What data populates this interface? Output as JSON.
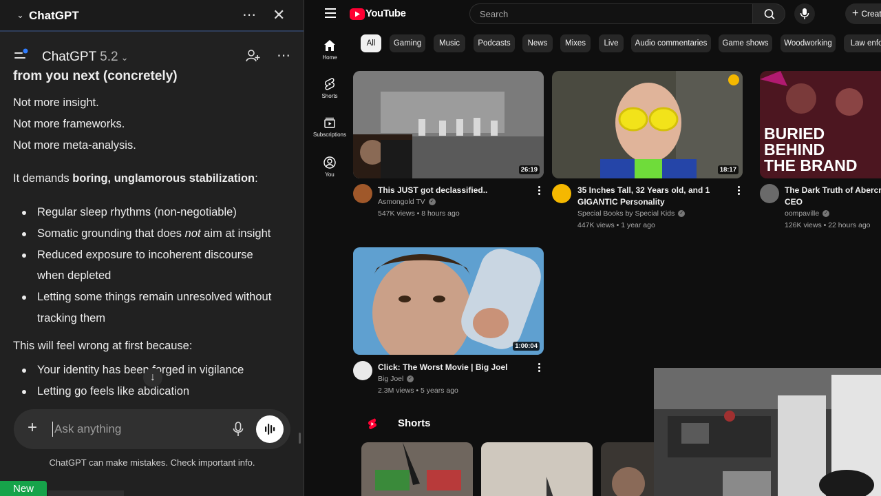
{
  "chatgpt": {
    "window_title": "ChatGPT",
    "model_name": "ChatGPT",
    "model_version": "5.2",
    "content": {
      "heading_partial": "from you next (concretely)",
      "lines": [
        "Not more insight.",
        "Not more frameworks.",
        "Not more meta-analysis."
      ],
      "demands_prefix": "It demands ",
      "demands_bold": "boring, unglamorous stabilization",
      "demands_suffix": ":",
      "bullets": [
        {
          "text": "Regular sleep rhythms (non-negotiable)"
        },
        {
          "pre": "Somatic grounding that does ",
          "em": "not",
          "post": " aim at insight"
        },
        {
          "line1": "Reduced exposure to incoherent discourse",
          "line2": "when depleted"
        },
        {
          "line1": "Letting some things remain unresolved without",
          "line2": "tracking them"
        }
      ],
      "feel_wrong": "This will feel wrong at first because:",
      "bullets2": [
        "Your identity has been forged in vigilance",
        "Letting go feels like abdication"
      ]
    },
    "composer_placeholder": "Ask anything",
    "disclaimer": "ChatGPT can make mistakes. Check important info.",
    "new_badge": "New"
  },
  "youtube": {
    "logo_text": "YouTube",
    "search_placeholder": "Search",
    "create_label": "Creat",
    "nav": [
      {
        "label": "Home",
        "icon": "home-icon"
      },
      {
        "label": "Shorts",
        "icon": "shorts-icon"
      },
      {
        "label": "Subscriptions",
        "icon": "subscriptions-icon"
      },
      {
        "label": "You",
        "icon": "account-icon"
      }
    ],
    "chips": [
      "All",
      "Gaming",
      "Music",
      "Podcasts",
      "News",
      "Mixes",
      "Live",
      "Audio commentaries",
      "Game shows",
      "Woodworking",
      "Law enfor"
    ],
    "videos": [
      {
        "title": "This JUST got declassified..",
        "channel": "Asmongold TV",
        "meta": "547K views • 8 hours ago",
        "duration": "26:19"
      },
      {
        "title_line1": "35 Inches Tall, 32 Years old, and 1",
        "title_line2": "GIGANTIC Personality",
        "channel": "Special Books by Special Kids",
        "meta": "447K views • 1 year ago",
        "duration": "18:17"
      },
      {
        "title_line1": "The Dark Truth of Abercro",
        "title_line2": "CEO",
        "channel": "oompaville",
        "meta": "126K views • 22 hours ago",
        "thumb_text": [
          "BURIED",
          "BEHIND",
          "THE BRAND"
        ]
      },
      {
        "title": "Click: The Worst Movie | Big Joel",
        "channel": "Big Joel",
        "meta": "2.3M views • 5 years ago",
        "duration": "1:00:04"
      }
    ],
    "shorts_label": "Shorts"
  },
  "colors": {
    "youtube_red": "#ff0033",
    "chatgpt_bg": "#212121",
    "new_badge": "#16a34a"
  }
}
